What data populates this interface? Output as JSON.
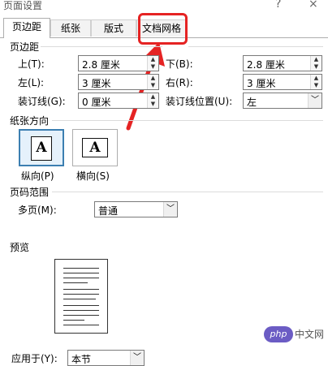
{
  "window": {
    "title": "页面设置",
    "help": "?",
    "close": "×"
  },
  "tabs": [
    {
      "label": "页边距",
      "active": true
    },
    {
      "label": "纸张",
      "active": false
    },
    {
      "label": "版式",
      "active": false
    },
    {
      "label": "文档网格",
      "active": false
    }
  ],
  "margins": {
    "heading": "页边距",
    "top_label": "上(T):",
    "top_value": "2.8 厘米",
    "bottom_label": "下(B):",
    "bottom_value": "2.8 厘米",
    "left_label": "左(L):",
    "left_value": "3 厘米",
    "right_label": "右(R):",
    "right_value": "3 厘米",
    "gutter_label": "装订线(G):",
    "gutter_value": "0 厘米",
    "gutter_pos_label": "装订线位置(U):",
    "gutter_pos_value": "左"
  },
  "orientation": {
    "heading": "纸张方向",
    "portrait_label": "纵向(P)",
    "landscape_label": "横向(S)",
    "icon_letter": "A",
    "selected": "portrait"
  },
  "pages": {
    "heading": "页码范围",
    "multiple_label": "多页(M):",
    "multiple_value": "普通"
  },
  "preview": {
    "heading": "预览"
  },
  "apply": {
    "label": "应用于(Y):",
    "value": "本节"
  },
  "watermark": {
    "logo": "php",
    "text": "中文网"
  },
  "colors": {
    "highlight": "#e52323",
    "selected_border": "#3c7fb1"
  }
}
